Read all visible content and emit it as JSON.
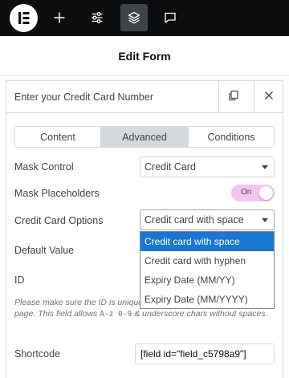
{
  "toolbar": {
    "logo_icon": "elementor-logo-icon",
    "buttons": [
      {
        "icon": "plus-icon"
      },
      {
        "icon": "sliders-icon"
      },
      {
        "icon": "layers-icon",
        "active": true
      },
      {
        "icon": "chat-icon"
      }
    ]
  },
  "header": {
    "title": "Edit Form"
  },
  "panel": {
    "title": "Enter your Credit Card Number",
    "copy_icon": "copy-icon",
    "close_icon": "close-icon"
  },
  "tabs": [
    {
      "label": "Content"
    },
    {
      "label": "Advanced",
      "active": true
    },
    {
      "label": "Conditions"
    }
  ],
  "fields": {
    "mask_control": {
      "label": "Mask Control",
      "value": "Credit Card"
    },
    "mask_placeholders": {
      "label": "Mask Placeholders",
      "toggle_label": "On",
      "checked": true
    },
    "credit_card_options": {
      "label": "Credit Card Options",
      "value": "Credit card with space"
    },
    "default_value": {
      "label": "Default Value"
    },
    "id": {
      "label": "ID"
    },
    "id_note": {
      "part1": "Please make sure the ID is unique and not used elsewhere on the page. This field allows ",
      "chars": "A-z 0-9",
      "part2": " & underscore chars without spaces."
    },
    "shortcode": {
      "label": "Shortcode",
      "value": "[field id=\"field_c5798a9\"]"
    }
  },
  "dropdown": {
    "options": [
      {
        "label": "Credit card with space",
        "selected": true
      },
      {
        "label": "Credit card with hyphen"
      },
      {
        "label": "Expiry Date (MM/YY)"
      },
      {
        "label": "Expiry Date (MM/YYYY)"
      }
    ]
  },
  "colors": {
    "topbar": "#0c0d0e",
    "toggle_on": "#f3c4f0",
    "selected_option": "#1976d2"
  }
}
